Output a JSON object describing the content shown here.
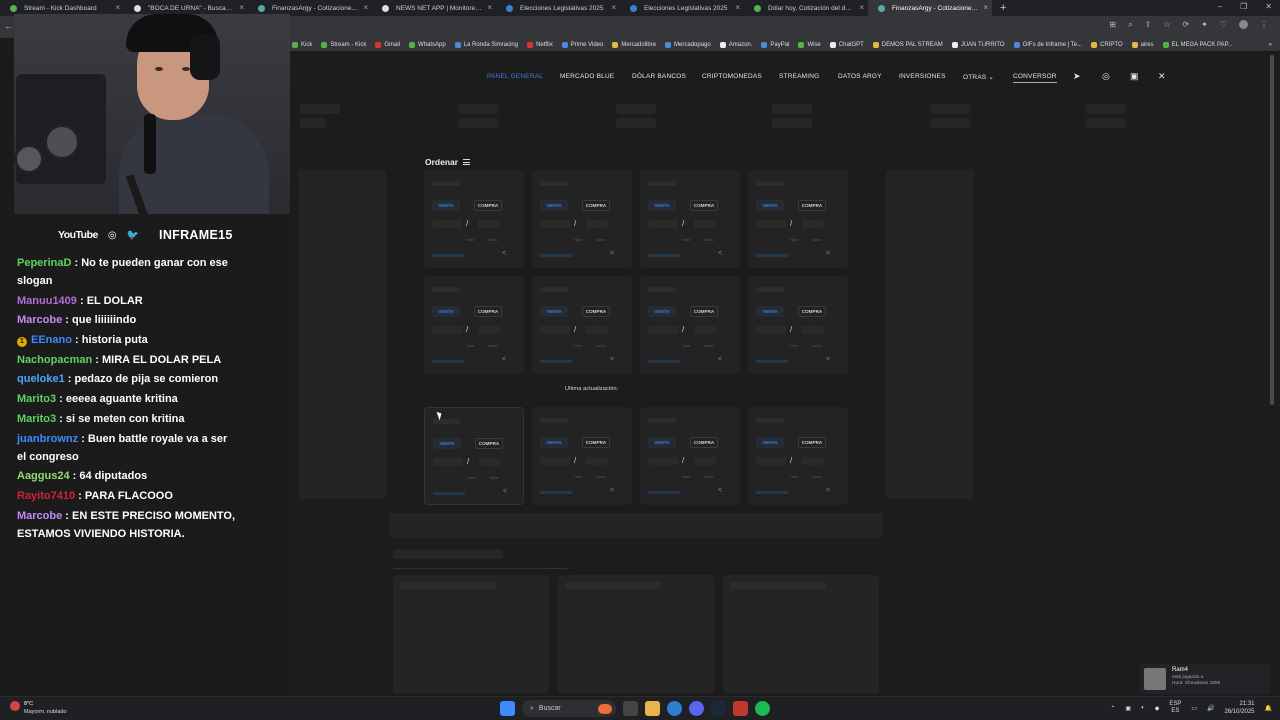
{
  "browser": {
    "tabs": [
      {
        "title": "Stream - Kick Dashboard",
        "active": false
      },
      {
        "title": "\"BOCA DE URNA\" - Buscar / X",
        "active": false
      },
      {
        "title": "FinanzasArgy - Cotizaciones en ti...",
        "active": false
      },
      {
        "title": "NEWS NET APP | Monitoreo de n...",
        "active": false
      },
      {
        "title": "Elecciones Legislativas 2025",
        "active": false
      },
      {
        "title": "Elecciones Legislativas 2025",
        "active": false
      },
      {
        "title": "Dólar hoy, Cotización del dólar |",
        "active": false
      },
      {
        "title": "FinanzasArgy - Cotizaciones en ti...",
        "active": true
      }
    ],
    "new_tab": "+",
    "bookmarks": [
      "Kick",
      "Stream - Kick",
      "Gmail",
      "WhatsApp",
      "La Ronda Simracing",
      "Netflix",
      "Prime Video",
      "Mercadolibre",
      "Mercadopago",
      "Amazon.",
      "PayPal",
      "Wise",
      "ChatGPT",
      "DEMOS PAL STREAM",
      "JUAN TURRITO",
      "GIFs de Inframe | Te...",
      "CRIPTO",
      "aires",
      "EL MEGA PACK PAP..."
    ]
  },
  "site": {
    "nav": {
      "panel": "PANEL GENERAL",
      "mercado": "MERCADO BLUE",
      "bancos": "DÓLAR BANCOS",
      "cripto": "CRIPTOMONEDAS",
      "streaming": "STREAMING",
      "datos": "DATOS ARGY",
      "inversiones": "INVERSIONES",
      "otras": "OTRAS",
      "otras_arrow": "⌄",
      "conversor": "CONVERSOR"
    },
    "social_icons": [
      "telegram-icon",
      "instagram-icon",
      "medium-icon",
      "x-icon"
    ],
    "ordenar": "Ordenar",
    "card": {
      "venta": "VENTA",
      "compra": "COMPRA",
      "slash": "/",
      "mini1": "Hace",
      "mini2": "Variac"
    },
    "ultima": "Ultima actualización:"
  },
  "stream": {
    "youtube": "YouTube",
    "handle": "INFRAME15",
    "chat": [
      {
        "user": "PeperinaD",
        "color": "#5fd45f",
        "text": "No te pueden ganar con ese slogan"
      },
      {
        "user": "Manuu1409",
        "color": "#b26cd9",
        "text": "EL DOLAR"
      },
      {
        "user": "Marcobe",
        "color": "#c58af9",
        "text": "que liiiiiindo"
      },
      {
        "user": "EEnano",
        "color": "#3d8bff",
        "text": "historia puta",
        "badge": "1"
      },
      {
        "user": "Nachopacman",
        "color": "#5fd45f",
        "text": "MIRA EL DOLAR PELA"
      },
      {
        "user": "queloke1",
        "color": "#4aa8ff",
        "text": "pedazo de pija se comieron"
      },
      {
        "user": "Marito3",
        "color": "#5fd45f",
        "text": "eeeea aguante kritina"
      },
      {
        "user": "Marito3",
        "color": "#5fd45f",
        "text": "si se meten con kritina"
      },
      {
        "user": "juanbrownz",
        "color": "#3d8bff",
        "text": "Buen battle royale va a ser el congreso"
      },
      {
        "user": "Aaggus24",
        "color": "#8fdc6b",
        "text": "64 diputados"
      },
      {
        "user": "Rayito7410",
        "color": "#d4213a",
        "text": "PARA FLACOOO"
      },
      {
        "user": "Marcobe",
        "color": "#c58af9",
        "text": "EN ESTE PRECISO MOMENTO, ESTAMOS VIVIENDO HISTORIA."
      }
    ]
  },
  "taskbar": {
    "weather_temp": "8°C",
    "weather_desc": "Mayorm. nublado",
    "search": "Buscar",
    "lang1": "ESP",
    "lang2": "ES",
    "time": "21:31",
    "date": "26/10/2025"
  },
  "toast": {
    "name": "Ram4",
    "line1": "está jugando a",
    "line2": "Hunt: Showdown 1896"
  }
}
